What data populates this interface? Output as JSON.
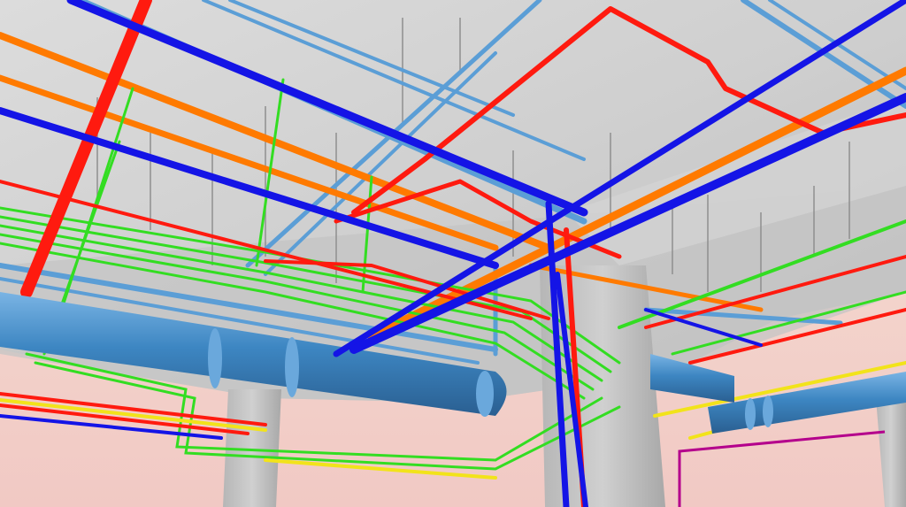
{
  "scene": {
    "description_visible_text": "",
    "colors": {
      "sky_top": "#f6e2d6",
      "sky_bottom": "#f1c9c4",
      "ceiling_light": "#d8d8d8",
      "ceiling_dark": "#b9b9b9",
      "column": "#c7c7c7",
      "column_shadow": "#a9a9a9",
      "duct": "#3d86c2",
      "duct_highlight": "#6aa8dc",
      "pipe_red": "#ff1a0f",
      "pipe_blue": "#1414e6",
      "pipe_orange": "#ff7a00",
      "pipe_green": "#33dd22",
      "pipe_lightblue": "#5b9ed6",
      "pipe_yellow": "#f2e31a",
      "pipe_magenta": "#b4008c"
    },
    "icons": [
      "concrete-ceiling",
      "concrete-column",
      "hvac-duct",
      "pipe-network",
      "cable-tray"
    ]
  }
}
